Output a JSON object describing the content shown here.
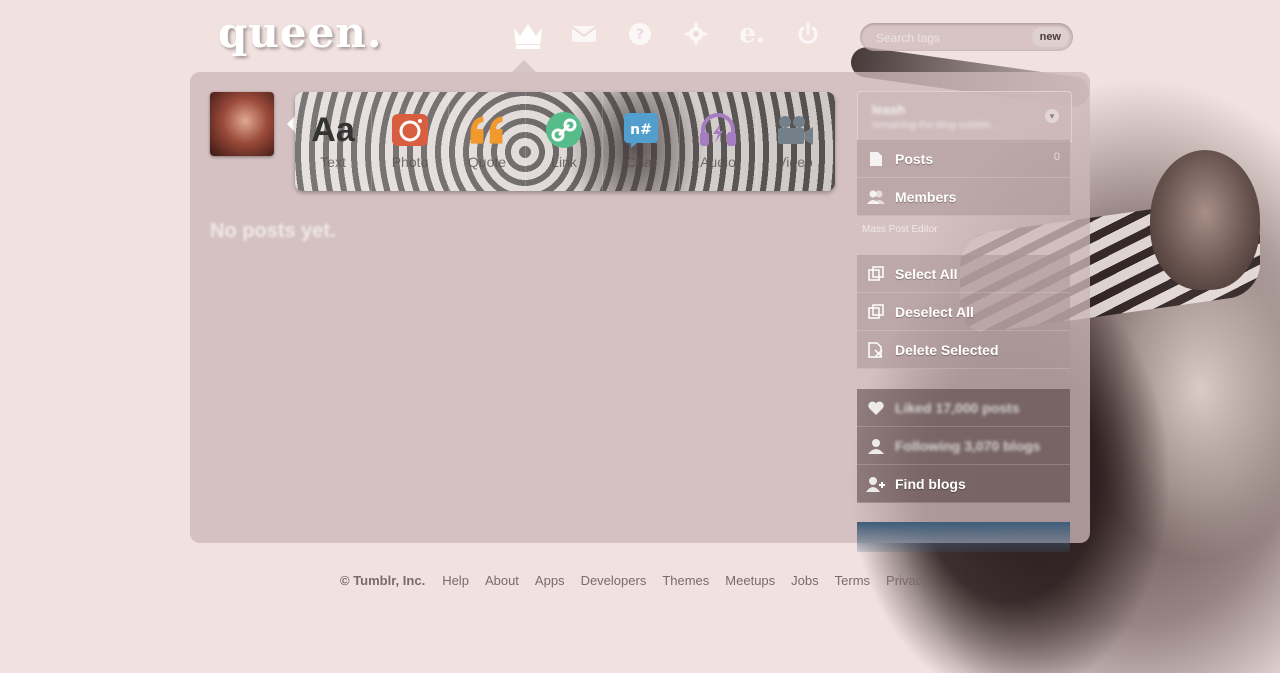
{
  "header": {
    "logo_text": "queen.",
    "nav_icons": [
      {
        "name": "dashboard-crown-icon",
        "glyph": "♕"
      },
      {
        "name": "messages-icon",
        "glyph": "✉"
      },
      {
        "name": "help-icon",
        "glyph": "?"
      },
      {
        "name": "settings-icon",
        "glyph": "✹"
      },
      {
        "name": "xkit-icon",
        "glyph": "e."
      },
      {
        "name": "power-icon",
        "glyph": "⏻"
      }
    ],
    "search": {
      "placeholder": "Search tags",
      "value": "",
      "new_label": "new"
    }
  },
  "post_types": [
    {
      "label": "Text",
      "color": "#444444"
    },
    {
      "label": "Photo",
      "color": "#d95e40"
    },
    {
      "label": "Quote",
      "color": "#f2992e"
    },
    {
      "label": "Link",
      "color": "#56bc8a"
    },
    {
      "label": "Chat",
      "color": "#529ecc"
    },
    {
      "label": "Audio",
      "color": "#a77dc2"
    },
    {
      "label": "Video",
      "color": "#748089"
    }
  ],
  "feed": {
    "empty_message": "No posts yet."
  },
  "sidebar": {
    "blog_name": "leash",
    "blog_subtitle": "remaining-the-blog-subtitle...",
    "menu": [
      {
        "label": "Posts",
        "count": "0",
        "icon": "posts-icon"
      },
      {
        "label": "Members",
        "count": "",
        "icon": "members-icon"
      }
    ],
    "mega_label": "Mass Post Editor",
    "editor_actions": [
      {
        "label": "Select All",
        "icon": "select-all-icon"
      },
      {
        "label": "Deselect All",
        "icon": "deselect-all-icon"
      },
      {
        "label": "Delete Selected",
        "icon": "delete-selected-icon"
      }
    ],
    "account": [
      {
        "label": "Liked 17,000 posts",
        "icon": "heart-icon"
      },
      {
        "label": "Following 3,070 blogs",
        "icon": "person-icon"
      },
      {
        "label": "Find blogs",
        "icon": "find-blogs-icon"
      }
    ]
  },
  "footer": {
    "copyright": "© Tumblr, Inc.",
    "links": [
      "Help",
      "About",
      "Apps",
      "Developers",
      "Themes",
      "Meetups",
      "Jobs",
      "Terms",
      "Privacy"
    ]
  },
  "colors": {
    "page_bg": "#f1e2e0",
    "panel_bg": "#cdb7b8",
    "accent_blue": "#3e5d7a"
  }
}
